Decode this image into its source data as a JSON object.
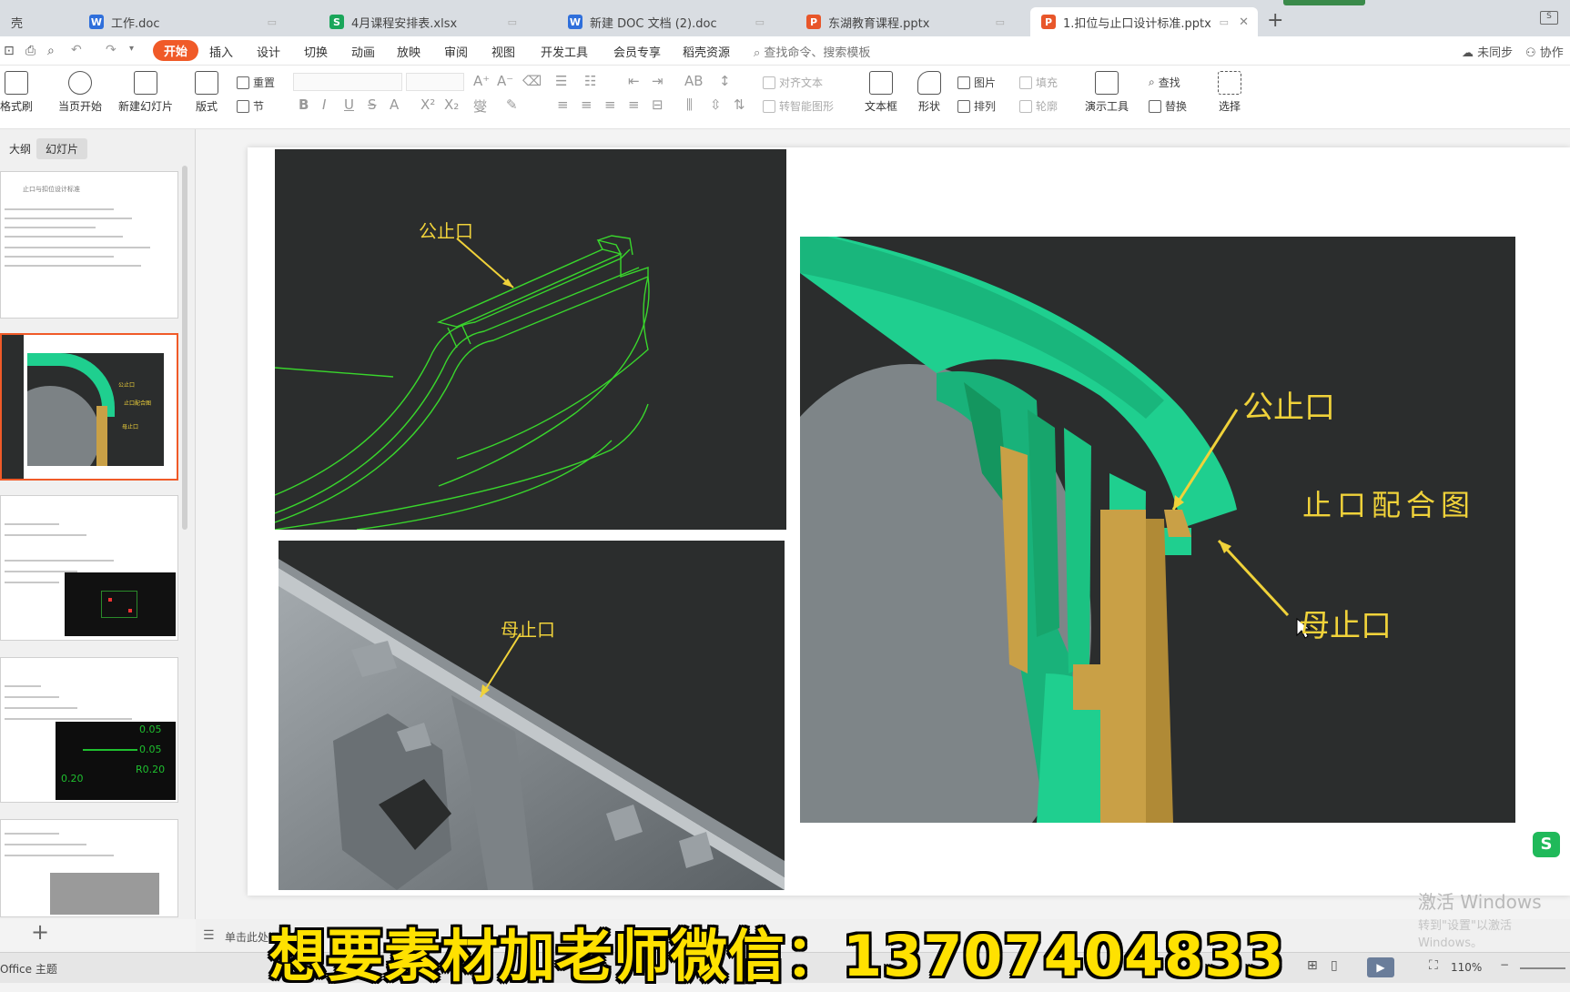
{
  "tabs": [
    {
      "label": "壳",
      "icon": "",
      "color": ""
    },
    {
      "label": "工作.doc",
      "icon": "W",
      "color": "#2f6fdb"
    },
    {
      "label": "4月课程安排表.xlsx",
      "icon": "S",
      "color": "#1aa65a"
    },
    {
      "label": "新建 DOC 文档 (2).doc",
      "icon": "W",
      "color": "#2f6fdb"
    },
    {
      "label": "东湖教育课程.pptx",
      "icon": "P",
      "color": "#e8562a"
    },
    {
      "label": "1.扣位与止口设计标准.pptx",
      "icon": "P",
      "color": "#e8562a"
    }
  ],
  "new_tab": "+",
  "menu": {
    "start": "开始",
    "insert": "插入",
    "design": "设计",
    "transition": "切换",
    "animation": "动画",
    "slideshow": "放映",
    "review": "审阅",
    "view": "视图",
    "devtools": "开发工具",
    "member": "会员专享",
    "resources": "稻壳资源",
    "search": "查找命令、搜索模板",
    "sync": "未同步",
    "collab": "协作"
  },
  "toolbar": {
    "format_painter": "格式刷",
    "play_current": "当页开始",
    "new_slide": "新建幻灯片",
    "layout": "版式",
    "reset": "重置",
    "section": "节",
    "align_text": "对齐文本",
    "smart_art": "转智能图形",
    "textbox": "文本框",
    "shape": "形状",
    "picture": "图片",
    "arrange": "排列",
    "fill": "填充",
    "outline": "轮廓",
    "present_tools": "演示工具",
    "find": "查找",
    "replace": "替换",
    "select": "选择"
  },
  "panel": {
    "outline_tab": "大纲",
    "slides_tab": "幻灯片",
    "add": "+",
    "thumb1_title": "止口与扣位设计标准"
  },
  "slide": {
    "label_male_top": "公止口",
    "label_female_bottom": "母止口",
    "label_male_right": "公止口",
    "label_title_right": "止口配合图",
    "label_female_right": "母止口"
  },
  "thumb_labels": {
    "a": "公止口",
    "b": "止口配合图",
    "c": "母止口"
  },
  "thumb_dims": [
    "0.05",
    "0.05",
    "R0.20",
    "0.20"
  ],
  "notes": {
    "hint": "单击此处添加备注"
  },
  "status": {
    "theme": "Office 主题",
    "zoom": "110%"
  },
  "banner": "想要素材加老师微信：13707404833",
  "watermark": {
    "line1": "激活 Windows",
    "line2": "转到\"设置\"以激活 Windows。"
  },
  "colors": {
    "accent": "#f05a28",
    "teal": "#1fcf8f",
    "gold": "#c9a046",
    "label": "#f0d23a",
    "wire": "#39d62c"
  }
}
